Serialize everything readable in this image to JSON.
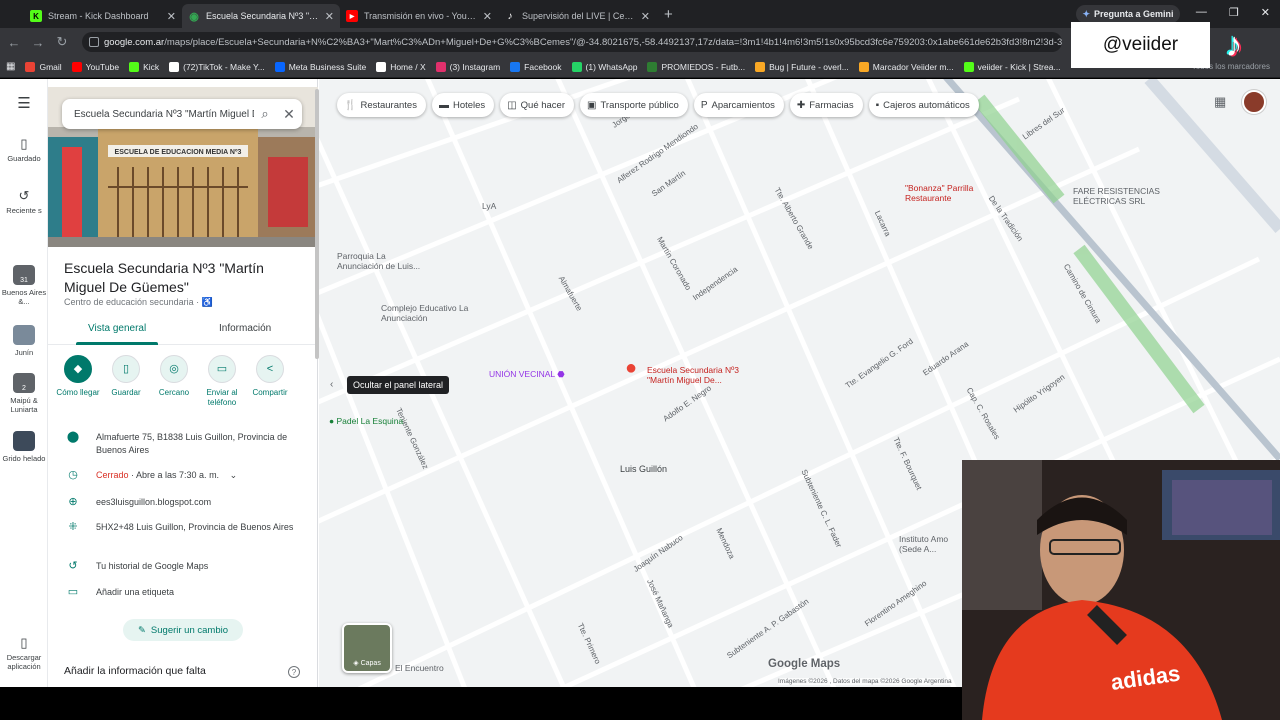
{
  "browser": {
    "tabs": [
      {
        "title": "Stream - Kick Dashboard",
        "color": "#53fc18",
        "glyph": "K"
      },
      {
        "title": "Escuela Secundaria Nº3 \"Martín",
        "color": "#34a853",
        "glyph": "◉"
      },
      {
        "title": "Transmisión en vivo - YouTube",
        "color": "#ff0000",
        "glyph": "▶"
      },
      {
        "title": "Supervisión del LIVE | Centro LI",
        "color": "#ffffff",
        "glyph": "♪"
      }
    ],
    "gemini_label": "Pregunta a Gemini",
    "url_site": "google.com.ar",
    "url_rest": "/maps/place/Escuela+Secundaria+N%C2%BA3+\"Mart%C3%ADn+Miguel+De+G%C3%BCemes\"/@-34.8021675,-58.4492137,17z/data=!3m1!4b1!4m6!3m5!1s0x95bcd3fc6e759203:0x1abe661de62b3fd3!8m2!3d-34.8021675!4d-58.4492137!1...",
    "bookmarks": [
      {
        "label": "Gmail",
        "color": "#ea4335"
      },
      {
        "label": "YouTube",
        "color": "#ff0000"
      },
      {
        "label": "Kick",
        "color": "#53fc18"
      },
      {
        "label": "(72)TikTok - Make Y...",
        "color": "#ffffff"
      },
      {
        "label": "Meta Business Suite",
        "color": "#0866ff"
      },
      {
        "label": "Home / X",
        "color": "#ffffff"
      },
      {
        "label": "(3) Instagram",
        "color": "#e1306c"
      },
      {
        "label": "Facebook",
        "color": "#1877f2"
      },
      {
        "label": "(1) WhatsApp",
        "color": "#25d366"
      },
      {
        "label": "PROMIEDOS - Futb...",
        "color": "#2e7d32"
      },
      {
        "label": "Bug | Future - overl...",
        "color": "#f9a825"
      },
      {
        "label": "Marcador Veiider m...",
        "color": "#f9a825"
      },
      {
        "label": "veiider - Kick | Strea...",
        "color": "#53fc18"
      }
    ],
    "bookmarks_right": "Todos los marcadores"
  },
  "overlay": {
    "handle": "@veiider"
  },
  "rail": {
    "saved": "Guardado",
    "recent": "Reciente s",
    "recents": [
      {
        "label": "Buenos Aires &...",
        "badge": "31"
      },
      {
        "label": "Junín",
        "badge": ""
      },
      {
        "label": "Maipú & Luniarta",
        "badge": "2"
      },
      {
        "label": "Grido helado",
        "badge": ""
      }
    ],
    "download": "Descargar aplicación"
  },
  "panel": {
    "search_value": "Escuela Secundaria Nº3 \"Martín Miguel De Güemes\"",
    "photo_sign": "ESCUELA DE EDUCACION MEDIA Nº3",
    "title": "Escuela Secundaria Nº3 \"Martín Miguel De Güemes\"",
    "category": "Centro de educación secundaria · ♿",
    "tab_overview": "Vista general",
    "tab_info": "Información",
    "actions": [
      {
        "label": "Cómo llegar",
        "icon": "◆"
      },
      {
        "label": "Guardar",
        "icon": "▯"
      },
      {
        "label": "Cercano",
        "icon": "◎"
      },
      {
        "label": "Enviar al teléfono",
        "icon": "▭"
      },
      {
        "label": "Compartir",
        "icon": "<"
      }
    ],
    "address": "Almafuerte 75, B1838 Luis Guillon, Provincia de Buenos Aires",
    "hours_status": "Cerrado",
    "hours_rest": " · Abre a las 7:30 a. m.",
    "website": "ees3luisguillon.blogspot.com",
    "plus_code": "5HX2+48 Luis Guillon, Provincia de Buenos Aires",
    "history": "Tu historial de Google Maps",
    "label_add": "Añadir una etiqueta",
    "suggest": "Sugerir un cambio",
    "missing_info": "Añadir la información que falta"
  },
  "map": {
    "chips": [
      {
        "label": "Restaurantes",
        "icon": "🍴"
      },
      {
        "label": "Hoteles",
        "icon": "▬"
      },
      {
        "label": "Qué hacer",
        "icon": "◫"
      },
      {
        "label": "Transporte público",
        "icon": "▣"
      },
      {
        "label": "Aparcamientos",
        "icon": "P"
      },
      {
        "label": "Farmacias",
        "icon": "✚"
      },
      {
        "label": "Cajeros automáticos",
        "icon": "▪"
      }
    ],
    "tooltip": "Ocultar el panel lateral",
    "layers_label": "Capas",
    "brand": "Google Maps",
    "attribution": "Imágenes ©2026 , Datos del mapa ©2026 Google   Argentina",
    "selected_place": "Escuela Secundaria Nº3 \"Martín Miguel De...",
    "pois": {
      "union_vecinal": "UNIÓN VECINAL",
      "padel": "Padel La Esquina",
      "parroquia": "Parroquia La Anunciación de Luis...",
      "complejo": "Complejo Educativo La Anunciación",
      "bonanza": "\"Bonanza\" Parrilla Restaurante",
      "fare": "FARE RESISTENCIAS ELÉCTRICAS SRL",
      "instituto": "Instituto Amo (Sede A...",
      "encuentro": "El Encuentro",
      "lya": "LyA",
      "town": "Luis Guillón"
    },
    "streets": [
      "Jorge Miñón",
      "Alferez Rodrigo Mendiondo",
      "San Martín",
      "Tte. Alberto Grande",
      "Independencia",
      "Martín Coronado",
      "Almafuerte",
      "Lacarra",
      "De la Tradición",
      "Libres del Sur",
      "Camino de Cintura",
      "Av. Sta Catalina",
      "Tte. Evangelio G. Ford",
      "Eduardo Arana",
      "Cap. C. Rosales",
      "Hipólito Yrigoyen",
      "Adolfo E. Negro",
      "Subteniente C. L. Fader",
      "Tte. F. Bourquet",
      "Mendoza",
      "Joaquín Nabuco",
      "José Mañanga",
      "Subteniente A. P. Gabastón",
      "Tte. Primero",
      "Teniente González",
      "Florentino Ameghino"
    ]
  }
}
